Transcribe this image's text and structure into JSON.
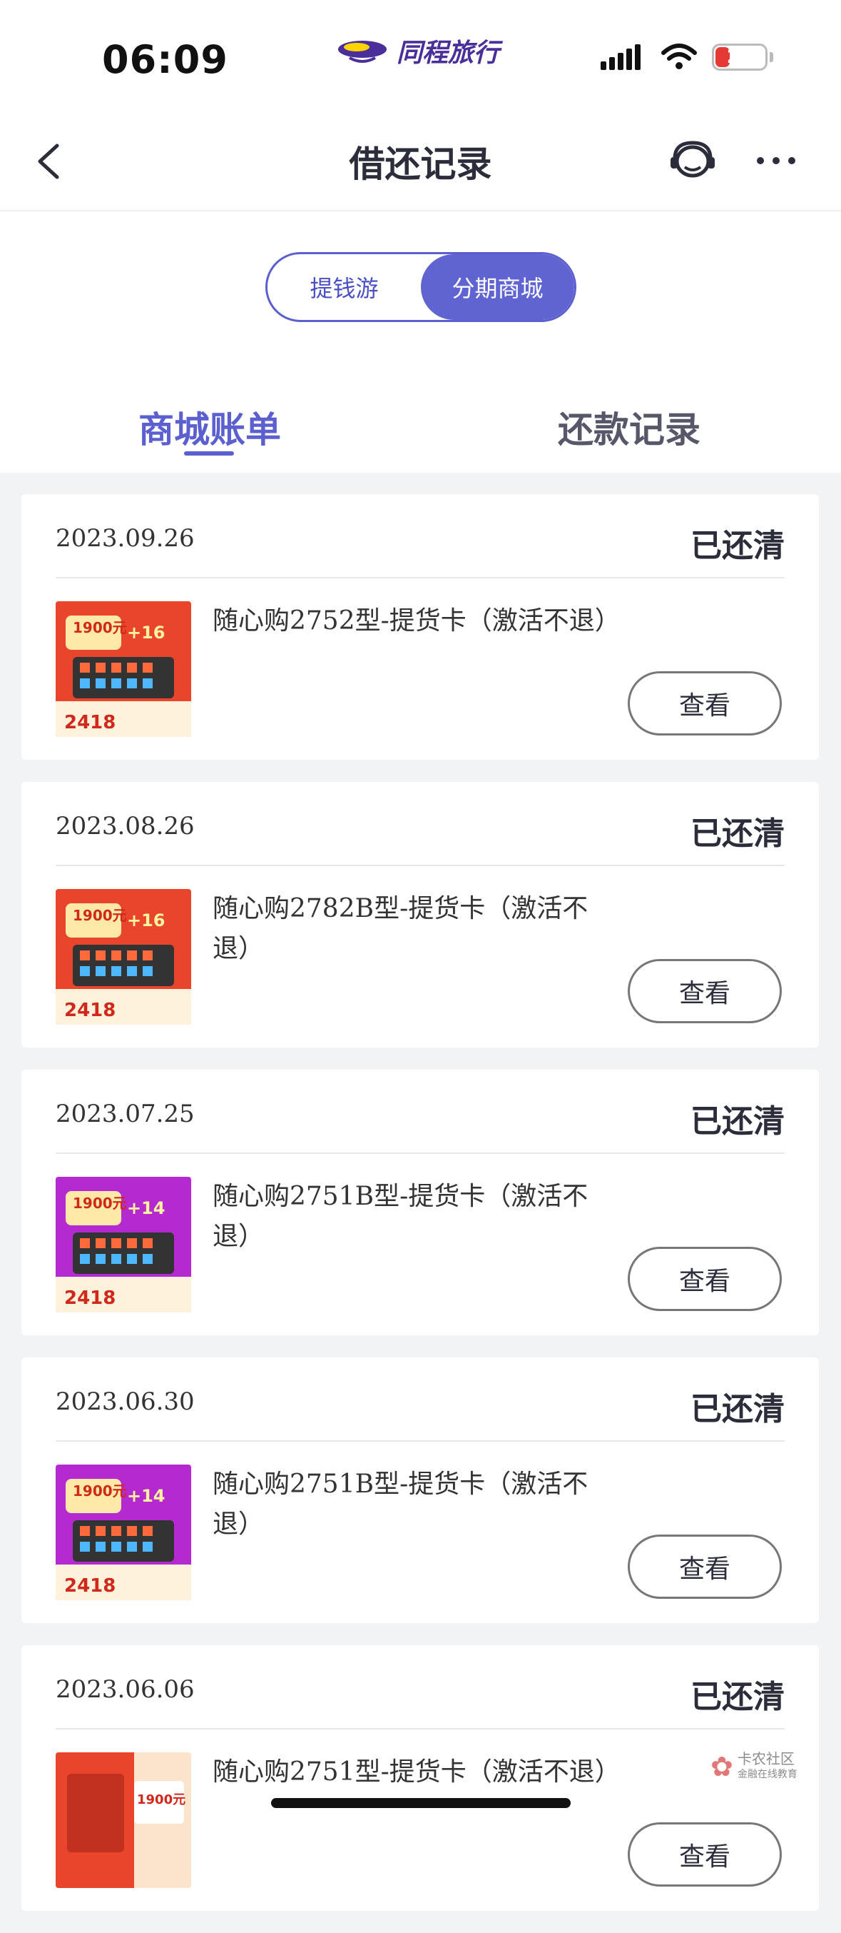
{
  "status_bar": {
    "time": "06:09",
    "battery": "20",
    "brand_name": "同程旅行"
  },
  "header": {
    "title": "借还记录"
  },
  "segment": {
    "left_label": "提钱游",
    "right_label": "分期商城",
    "selected": "分期商城"
  },
  "tabs": {
    "active_label": "商城账单",
    "inactive_label": "还款记录"
  },
  "records": [
    {
      "date": "2023.09.26",
      "status": "已还清",
      "product": "随心购2752型-提货卡（激活不退）",
      "action": "查看",
      "thumb": {
        "price": "2418",
        "face_value": "1900元",
        "count": "+16"
      }
    },
    {
      "date": "2023.08.26",
      "status": "已还清",
      "product": "随心购2782B型-提货卡（激活不退）",
      "action": "查看",
      "thumb": {
        "price": "2418",
        "face_value": "1900元",
        "count": "+16"
      }
    },
    {
      "date": "2023.07.25",
      "status": "已还清",
      "product": "随心购2751B型-提货卡（激活不退）",
      "action": "查看",
      "thumb": {
        "price": "2418",
        "face_value": "1900元",
        "count": "+14"
      }
    },
    {
      "date": "2023.06.30",
      "status": "已还清",
      "product": "随心购2751B型-提货卡（激活不退）",
      "action": "查看",
      "thumb": {
        "price": "2418",
        "face_value": "1900元",
        "count": "+14"
      }
    },
    {
      "date": "2023.06.06",
      "status": "已还清",
      "product": "随心购2751型-提货卡（激活不退）",
      "action": "查看",
      "thumb": {
        "price": "",
        "face_value": "1900元",
        "count": ""
      }
    }
  ],
  "watermark": {
    "text": "卡农社区",
    "subtext": "金融在线教育"
  },
  "colors": {
    "accent": "#5b5fcf",
    "background": "#f2f3f5",
    "thumb_red": "#e8452c",
    "thumb_purple": "#b52ad0"
  }
}
